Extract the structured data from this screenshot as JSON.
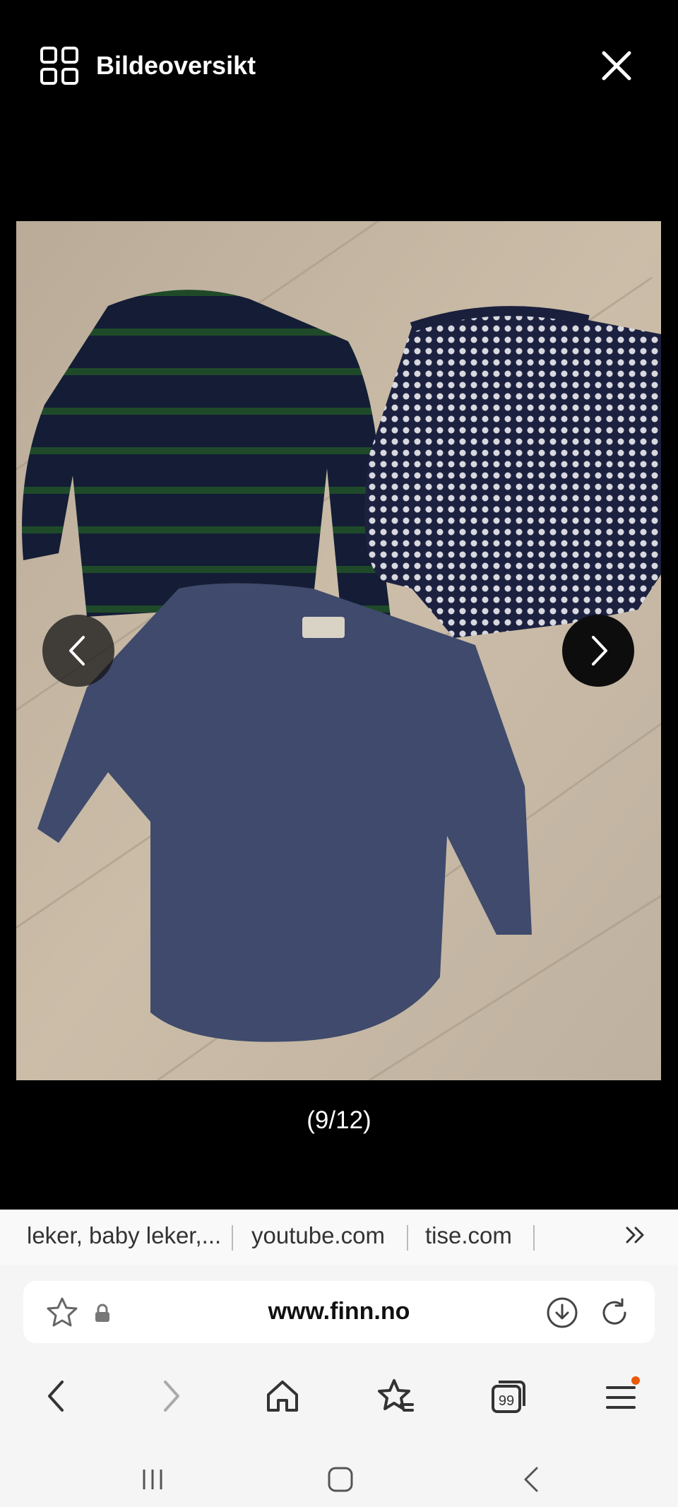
{
  "viewer": {
    "title": "Bildeoversikt",
    "counter": "(9/12)"
  },
  "quick_links": [
    {
      "label": "leker, baby leker,..."
    },
    {
      "label": "youtube.com"
    },
    {
      "label": "tise.com"
    }
  ],
  "address_bar": {
    "url": "www.finn.no"
  },
  "colors": {
    "viewer_bg": "#000000",
    "browser_bg": "#f5f5f5",
    "notification_dot": "#e8590c"
  }
}
